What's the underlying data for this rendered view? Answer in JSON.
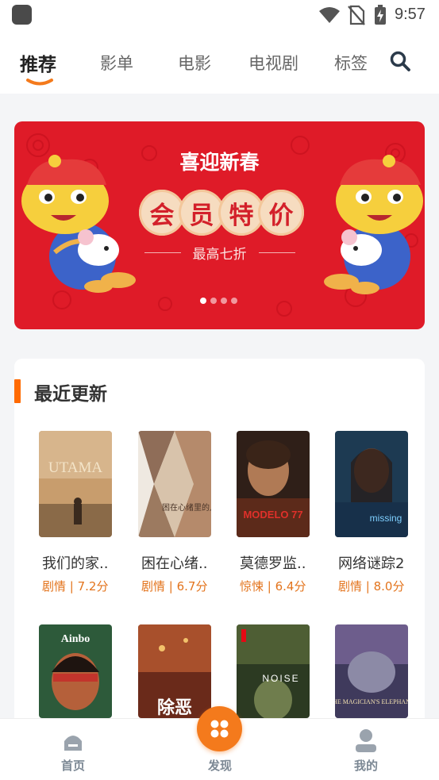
{
  "status_bar": {
    "time": "9:57",
    "icons": [
      "app-icon",
      "wifi-icon",
      "no-sim-icon",
      "battery-charging-icon"
    ]
  },
  "tabs": [
    {
      "label": "推荐",
      "active": true
    },
    {
      "label": "影单",
      "active": false
    },
    {
      "label": "电影",
      "active": false
    },
    {
      "label": "电视剧",
      "active": false
    },
    {
      "label": "标签",
      "active": false
    }
  ],
  "search_icon": "search-icon",
  "banner": {
    "title": "喜迎新春",
    "highlight_chars": [
      "会",
      "员",
      "特",
      "价"
    ],
    "subtitle": "最高七折",
    "dot_count": 4,
    "active_dot": 0,
    "colors": {
      "background": "#df1b28",
      "pill": "#f6dcc0",
      "pill_text": "#d3202a"
    }
  },
  "recent": {
    "title": "最近更新",
    "accent": "#ff6a00",
    "movies": [
      {
        "title": "我们的家..",
        "genre": "剧情",
        "score": "7.2分",
        "meta": "剧情 | 7.2分",
        "poster_text": "UTAMA"
      },
      {
        "title": "困在心绪..",
        "genre": "剧情",
        "score": "6.7分",
        "meta": "剧情 | 6.7分",
        "poster_text": "困在心绪里的儿子"
      },
      {
        "title": "莫德罗监..",
        "genre": "惊悚",
        "score": "6.4分",
        "meta": "惊悚 | 6.4分",
        "poster_text": "MODELO 77"
      },
      {
        "title": "网络谜踪2",
        "genre": "剧情",
        "score": "8.0分",
        "meta": "剧情 | 8.0分",
        "poster_text": "missing"
      },
      {
        "title": "",
        "genre": "",
        "score": "",
        "meta": "",
        "poster_text": "Ainbo"
      },
      {
        "title": "",
        "genre": "",
        "score": "",
        "meta": "",
        "poster_text": "除恶"
      },
      {
        "title": "",
        "genre": "",
        "score": "",
        "meta": "",
        "poster_text": "NOISE"
      },
      {
        "title": "",
        "genre": "",
        "score": "",
        "meta": "",
        "poster_text": "THE MAGICIAN'S ELEPHANT"
      }
    ]
  },
  "bottom_nav": {
    "items": [
      {
        "label": "首页",
        "icon": "home-icon"
      },
      {
        "label": "发现",
        "icon": "discover-icon"
      },
      {
        "label": "我的",
        "icon": "profile-icon"
      }
    ],
    "accent": "#f47a1c"
  }
}
